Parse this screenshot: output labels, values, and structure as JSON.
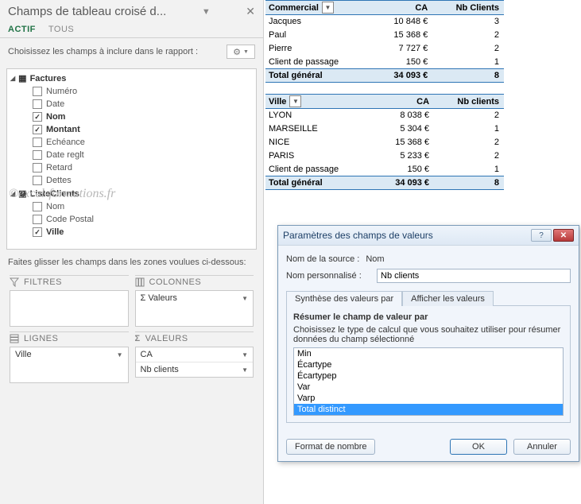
{
  "pane": {
    "title": "Champs de tableau croisé d...",
    "tab_active": "ACTIF",
    "tab_all": "TOUS",
    "choose_text": "Choisissez les champs à inclure dans le rapport :",
    "groups": [
      {
        "name": "Factures",
        "items": [
          {
            "label": "Numéro",
            "checked": false
          },
          {
            "label": "Date",
            "checked": false
          },
          {
            "label": "Nom",
            "checked": true
          },
          {
            "label": "Montant",
            "checked": true
          },
          {
            "label": "Echéance",
            "checked": false
          },
          {
            "label": "Date reglt",
            "checked": false
          },
          {
            "label": "Retard",
            "checked": false
          },
          {
            "label": "Dettes",
            "checked": false
          }
        ]
      },
      {
        "name": "ListeClients",
        "items": [
          {
            "label": "Nom",
            "checked": false
          },
          {
            "label": "Code Postal",
            "checked": false
          },
          {
            "label": "Ville",
            "checked": true
          }
        ]
      }
    ],
    "watermark": "©excel-formations.fr",
    "drag_hint": "Faites glisser les champs dans les zones voulues ci-dessous:",
    "zone_filters": "FILTRES",
    "zone_columns": "COLONNES",
    "zone_rows": "LIGNES",
    "zone_values": "VALEURS",
    "col_item": "Valeurs",
    "row_item": "Ville",
    "val_item1": "CA",
    "val_item2": "Nb clients",
    "sigma": "Σ"
  },
  "pivot1": {
    "headers": [
      "Commercial",
      "CA",
      "Nb Clients"
    ],
    "rows": [
      [
        "Jacques",
        "10 848 €",
        "3"
      ],
      [
        "Paul",
        "15 368 €",
        "2"
      ],
      [
        "Pierre",
        "7 727 €",
        "2"
      ],
      [
        "Client de passage",
        "150 €",
        "1"
      ]
    ],
    "total": [
      "Total général",
      "34 093 €",
      "8"
    ]
  },
  "pivot2": {
    "headers": [
      "Ville",
      "CA",
      "Nb clients"
    ],
    "rows": [
      [
        "LYON",
        "8 038 €",
        "2"
      ],
      [
        "MARSEILLE",
        "5 304 €",
        "1"
      ],
      [
        "NICE",
        "15 368 €",
        "2"
      ],
      [
        "PARIS",
        "5 233 €",
        "2"
      ],
      [
        "Client de passage",
        "150 €",
        "1"
      ]
    ],
    "total": [
      "Total général",
      "34 093 €",
      "8"
    ]
  },
  "dialog": {
    "title": "Paramètres des champs de valeurs",
    "src_label": "Nom de la source :",
    "src_value": "Nom",
    "custom_label": "Nom personnalisé :",
    "custom_value": "Nb clients",
    "tab_a": "Synthèse des valeurs par",
    "tab_b": "Afficher les valeurs",
    "subhead": "Résumer le champ de valeur par",
    "desc": "Choisissez le type de calcul que vous souhaitez utiliser pour résumer données du champ sélectionné",
    "options": [
      "Min",
      "Écartype",
      "Écartypep",
      "Var",
      "Varp",
      "Total distinct"
    ],
    "selected_index": 5,
    "btn_format": "Format de nombre",
    "btn_ok": "OK",
    "btn_cancel": "Annuler"
  }
}
